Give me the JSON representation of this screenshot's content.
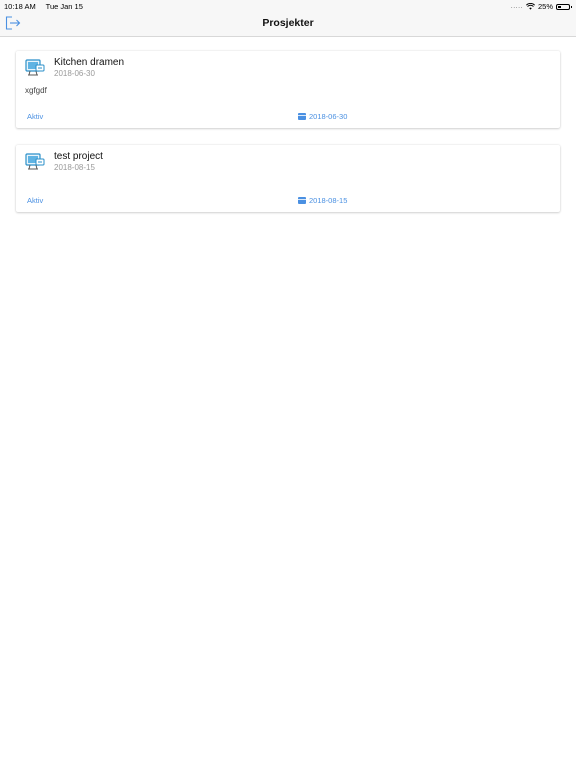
{
  "status_bar": {
    "time": "10:18 AM",
    "date": "Tue Jan 15",
    "battery": "25%",
    "battery_level": 0.25,
    "icons": [
      "signal-dots-icon",
      "wifi-icon",
      "battery-icon"
    ]
  },
  "nav": {
    "title": "Prosjekter",
    "left_icon": "logout-icon"
  },
  "projects": [
    {
      "name": "Kitchen dramen",
      "date": "2018-06-30",
      "description": "xgfgdf",
      "status": "Aktiv",
      "due_date": "2018-06-30",
      "icon": "project-icon"
    },
    {
      "name": "test project",
      "date": "2018-08-15",
      "description": "",
      "status": "Aktiv",
      "due_date": "2018-08-15",
      "icon": "project-icon"
    }
  ],
  "colors": {
    "accent": "#4a90e2",
    "secondary_text": "#9a9a9a",
    "bar_background": "#f7f7f7"
  }
}
